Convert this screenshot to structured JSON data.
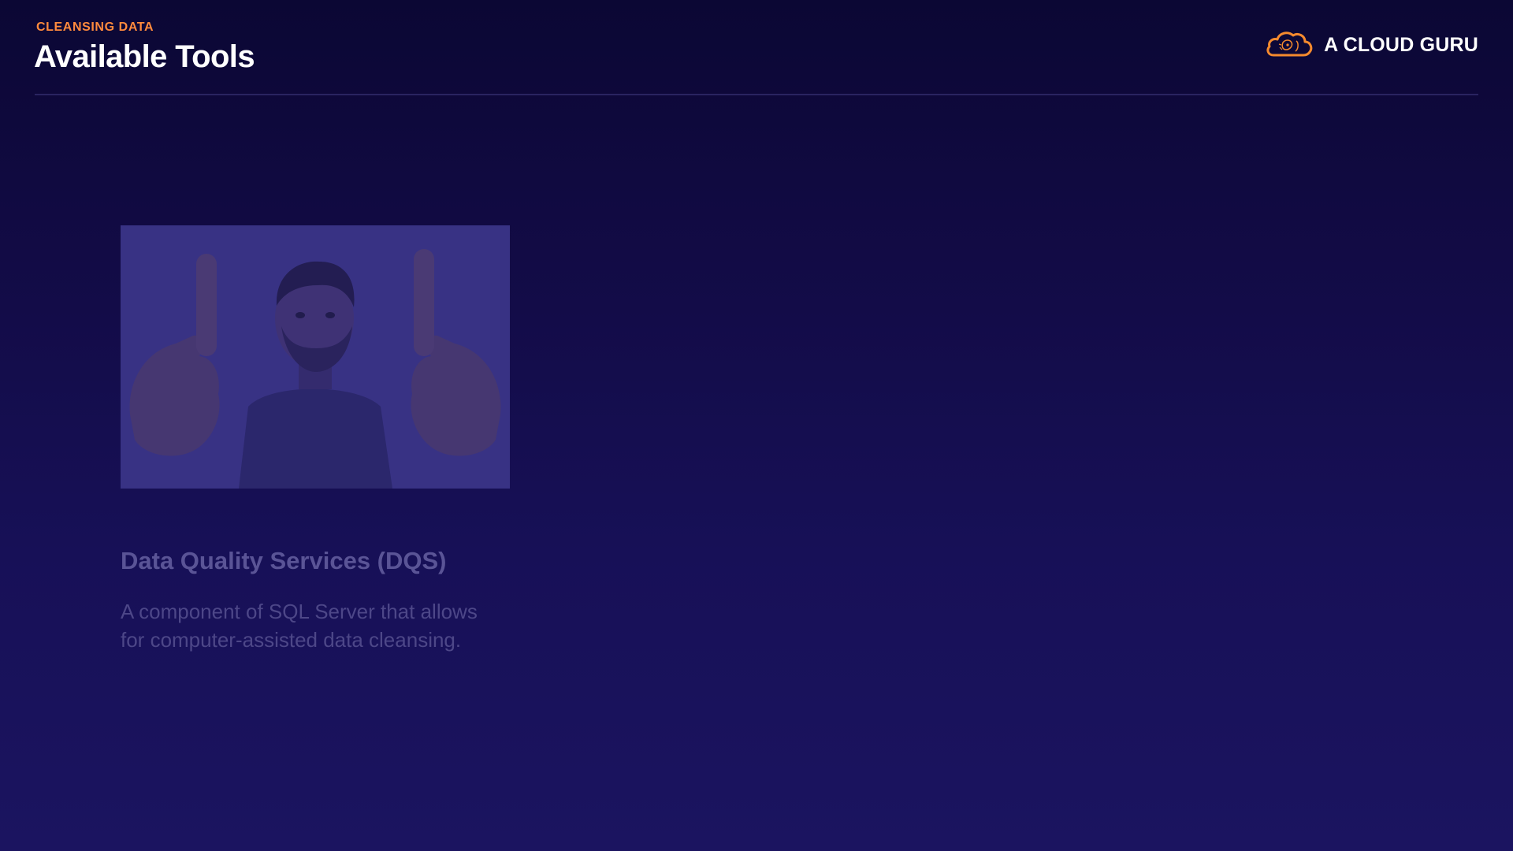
{
  "header": {
    "eyebrow": "CLEANSING DATA",
    "title": "Available Tools"
  },
  "brand": {
    "name": "A CLOUD GURU",
    "logo_icon": "cloud-logo-icon",
    "logo_color": "#f58a2e"
  },
  "card": {
    "image": "presenter-thumbs-up-photo",
    "title": "Data Quality Services (DQS)",
    "description": "A component of SQL Server that allows for computer-assisted data cleansing."
  },
  "colors": {
    "accent": "#ff8a3d",
    "background_top": "#0b0734",
    "background_bottom": "#1b1460",
    "title": "#ffffff",
    "faded_text": "#5a5496"
  }
}
